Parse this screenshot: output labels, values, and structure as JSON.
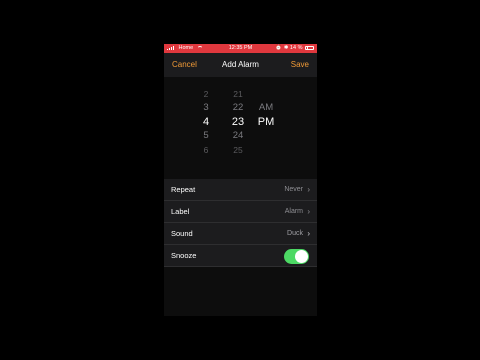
{
  "status_bar": {
    "carrier": "Home",
    "time": "12:35 PM",
    "battery": "14 %",
    "battery_level": 0.14,
    "color": "#e0383e"
  },
  "nav": {
    "cancel_label": "Cancel",
    "title": "Add Alarm",
    "save_label": "Save",
    "accent_color": "#f09a37"
  },
  "picker": {
    "hours": [
      "2",
      "3",
      "4",
      "5",
      "6"
    ],
    "minutes": [
      "21",
      "22",
      "23",
      "24",
      "25"
    ],
    "ampm": [
      "AM",
      "PM"
    ],
    "selected_hour": "4",
    "selected_minute": "23",
    "selected_ampm": "PM"
  },
  "settings": {
    "repeat": {
      "label": "Repeat",
      "value": "Never"
    },
    "label": {
      "label": "Label",
      "value": "Alarm"
    },
    "sound": {
      "label": "Sound",
      "value": "Duck"
    },
    "snooze": {
      "label": "Snooze",
      "enabled": true,
      "color": "#4cd964"
    }
  },
  "icons": {
    "chevron": "›"
  }
}
